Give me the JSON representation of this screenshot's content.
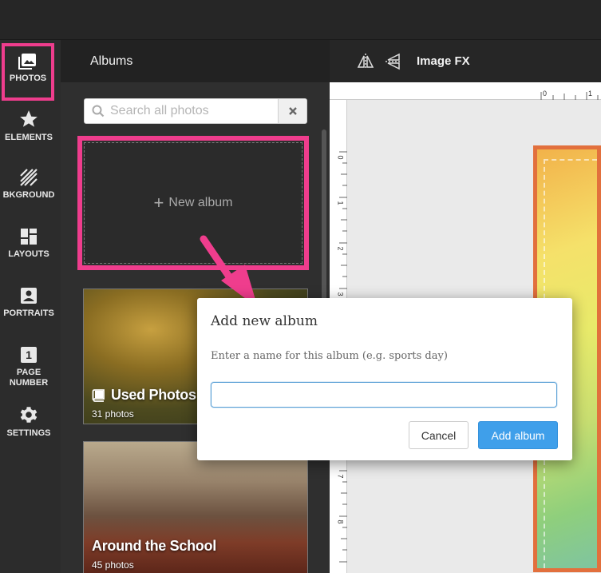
{
  "rail": {
    "items": [
      {
        "label": "PHOTOS",
        "icon": "photos-icon",
        "active": true
      },
      {
        "label": "ELEMENTS",
        "icon": "star-icon"
      },
      {
        "label": "BKGROUND",
        "icon": "background-stripes-icon"
      },
      {
        "label": "LAYOUTS",
        "icon": "layouts-grid-icon"
      },
      {
        "label": "PORTRAITS",
        "icon": "portrait-icon"
      },
      {
        "label": "PAGE NUMBER",
        "icon": "page-number-icon",
        "badge": "1"
      },
      {
        "label": "SETTINGS",
        "icon": "gear-icon"
      }
    ]
  },
  "panel": {
    "title": "Albums",
    "search_placeholder": "Search all photos",
    "new_album_label": "New album",
    "albums": [
      {
        "name": "Used Photos",
        "count": "31 photos",
        "icon": "book-icon"
      },
      {
        "name": "Around the School",
        "count": "45 photos"
      }
    ]
  },
  "fxbar": {
    "label": "Image FX"
  },
  "rulers": {
    "top": [
      "0",
      "1"
    ],
    "left": [
      "0",
      "1",
      "2",
      "3",
      "7",
      "8"
    ]
  },
  "dialog": {
    "title": "Add new album",
    "description": "Enter a name for this album (e.g. sports day)",
    "input_value": "",
    "cancel_label": "Cancel",
    "add_label": "Add album"
  },
  "colors": {
    "highlight": "#ef3d8d",
    "primary_button": "#3f9fea"
  }
}
